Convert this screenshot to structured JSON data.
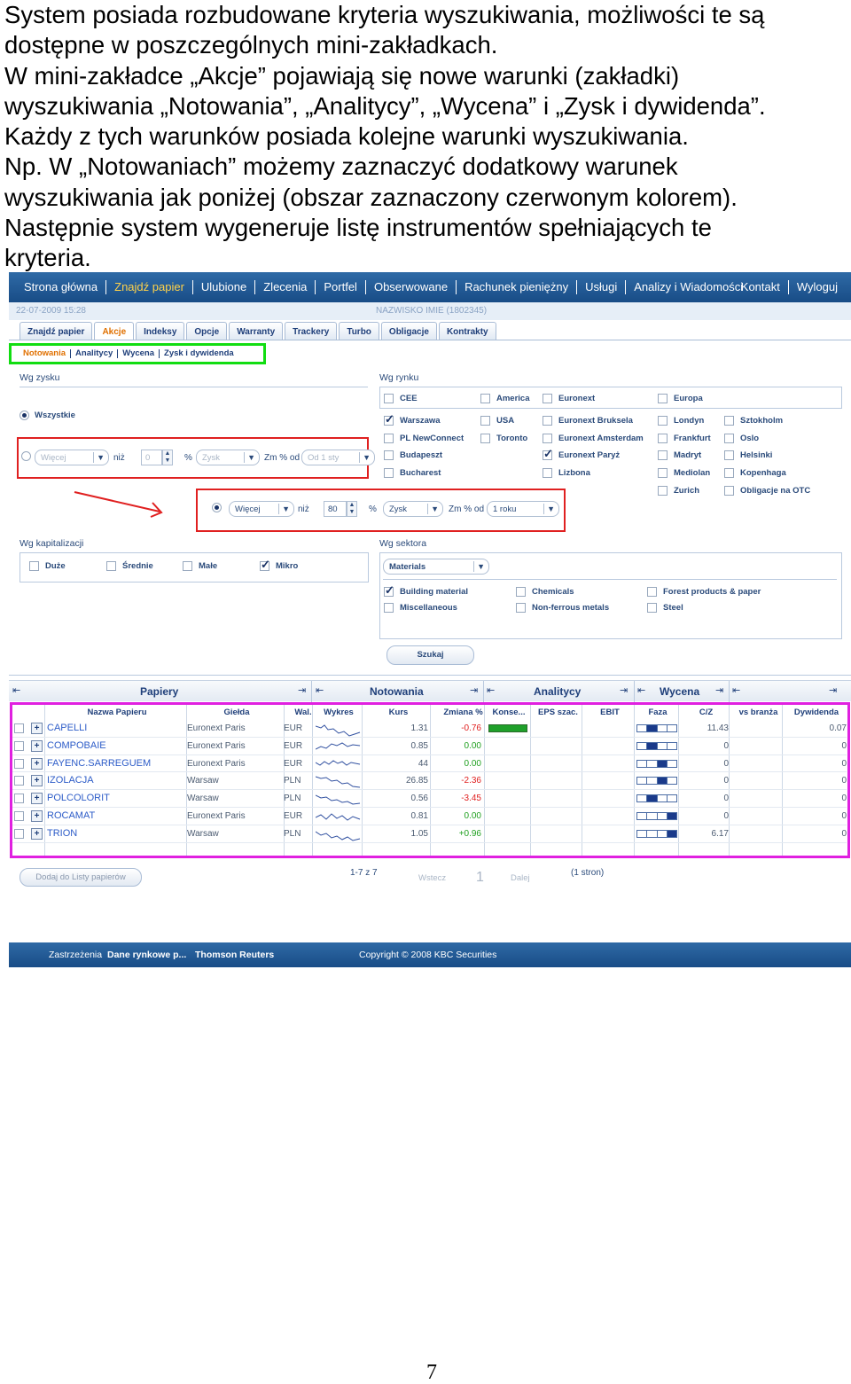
{
  "intro_lines": [
    "System posiada rozbudowane kryteria wyszukiwania, możliwości te są",
    "dostępne w poszczególnych mini-zakładkach.",
    "W mini-zakładce „Akcje” pojawiają się nowe warunki (zakładki)",
    "wyszukiwania „Notowania”, „Analitycy”, „Wycena” i „Zysk i dywidenda”.",
    "Każdy z tych warunków posiada kolejne warunki wyszukiwania.",
    "Np. W „Notowaniach” możemy zaznaczyć dodatkowy warunek",
    "wyszukiwania jak poniżej (obszar zaznaczony czerwonym kolorem).",
    "Następnie system wygeneruje listę instrumentów spełniających te",
    "kryteria."
  ],
  "topnav": {
    "items": [
      "Strona główna",
      "Znajdź papier",
      "Ulubione",
      "Zlecenia",
      "Portfel",
      "Obserwowane",
      "Rachunek pieniężny",
      "Usługi",
      "Analizy i Wiadomości"
    ],
    "right": [
      "Kontakt",
      "Wyloguj"
    ]
  },
  "infobar": {
    "date": "22-07-2009 15:28",
    "user": "NAZWISKO IMIE (1802345)"
  },
  "tabs": [
    "Znajdź papier",
    "Akcje",
    "Indeksy",
    "Opcje",
    "Warranty",
    "Trackery",
    "Turbo",
    "Obligacje",
    "Kontrakty"
  ],
  "subtabs": [
    "Notowania",
    "Analitycy",
    "Wycena",
    "Zysk i dywidenda"
  ],
  "zysk": {
    "label": "Wg zysku",
    "all": "Wszystkie",
    "more": "Więcej",
    "than": "niż",
    "value": "0",
    "pct": "%",
    "metric": "Zysk",
    "change": "Zm % od",
    "from": "Od 1 sty"
  },
  "zysk_expanded": {
    "more": "Więcej",
    "than": "niż",
    "value": "80",
    "pct": "%",
    "metric": "Zysk",
    "change": "Zm % od",
    "from": "1 roku"
  },
  "rynek": {
    "label": "Wg rynku",
    "items": [
      {
        "name": "CEE",
        "checked": false
      },
      {
        "name": "America",
        "checked": false
      },
      {
        "name": "Euronext",
        "checked": false
      },
      {
        "name": "Europa",
        "checked": false
      },
      {
        "name": "Warszawa",
        "checked": true
      },
      {
        "name": "USA",
        "checked": false
      },
      {
        "name": "Euronext Bruksela",
        "checked": false
      },
      {
        "name": "Londyn",
        "checked": false
      },
      {
        "name": "Sztokholm",
        "checked": false
      },
      {
        "name": "PL NewConnect",
        "checked": false
      },
      {
        "name": "Toronto",
        "checked": false
      },
      {
        "name": "Euronext Amsterdam",
        "checked": false
      },
      {
        "name": "Frankfurt",
        "checked": false
      },
      {
        "name": "Oslo",
        "checked": false
      },
      {
        "name": "Budapeszt",
        "checked": false
      },
      {
        "name": "Euronext Paryż",
        "checked": true
      },
      {
        "name": "Madryt",
        "checked": false
      },
      {
        "name": "Helsinki",
        "checked": false
      },
      {
        "name": "Bucharest",
        "checked": false
      },
      {
        "name": "Lizbona",
        "checked": false
      },
      {
        "name": "Mediolan",
        "checked": false
      },
      {
        "name": "Kopenhaga",
        "checked": false
      },
      {
        "name": "Zurich",
        "checked": false
      },
      {
        "name": "Obligacje na OTC",
        "checked": false
      }
    ]
  },
  "kapitalizacja": {
    "label": "Wg kapitalizacji",
    "items": [
      {
        "name": "Duże",
        "checked": false
      },
      {
        "name": "Średnie",
        "checked": false
      },
      {
        "name": "Małe",
        "checked": false
      },
      {
        "name": "Mikro",
        "checked": true
      }
    ]
  },
  "sektor": {
    "label": "Wg sektora",
    "selected": "Materials",
    "items": [
      {
        "name": "Building material",
        "checked": true
      },
      {
        "name": "Chemicals",
        "checked": false
      },
      {
        "name": "Forest products & paper",
        "checked": false
      },
      {
        "name": "Miscellaneous",
        "checked": false
      },
      {
        "name": "Non-ferrous metals",
        "checked": false
      },
      {
        "name": "Steel",
        "checked": false
      }
    ]
  },
  "search_button": "Szukaj",
  "groups": [
    "Papiery",
    "Notowania",
    "Analitycy",
    "Wycena"
  ],
  "columns": [
    "Nazwa Papieru",
    "Giełda",
    "Wal.",
    "Wykres",
    "Kurs",
    "Zmiana %",
    "Konse...",
    "EPS szac.",
    "EBIT",
    "Faza",
    "C/Z",
    "vs branża",
    "Dywidenda"
  ],
  "rows": [
    {
      "name": "CAPELLI",
      "exchange": "Euronext Paris",
      "currency": "EUR",
      "price": "1.31",
      "change": "-0.76",
      "consensus": 1.0,
      "faza": 1,
      "cz": "11.43",
      "div": "0.07"
    },
    {
      "name": "COMPOBAIE",
      "exchange": "Euronext Paris",
      "currency": "EUR",
      "price": "0.85",
      "change": "0.00",
      "consensus": 0,
      "faza": 1,
      "cz": "0",
      "div": "0"
    },
    {
      "name": "FAYENC.SARREGUEM",
      "exchange": "Euronext Paris",
      "currency": "EUR",
      "price": "44",
      "change": "0.00",
      "consensus": 0,
      "faza": 2,
      "cz": "0",
      "div": "0"
    },
    {
      "name": "IZOLACJA",
      "exchange": "Warsaw",
      "currency": "PLN",
      "price": "26.85",
      "change": "-2.36",
      "consensus": 0,
      "faza": 2,
      "cz": "0",
      "div": "0"
    },
    {
      "name": "POLCOLORIT",
      "exchange": "Warsaw",
      "currency": "PLN",
      "price": "0.56",
      "change": "-3.45",
      "consensus": 0,
      "faza": 1,
      "cz": "0",
      "div": "0"
    },
    {
      "name": "ROCAMAT",
      "exchange": "Euronext Paris",
      "currency": "EUR",
      "price": "0.81",
      "change": "0.00",
      "consensus": 0,
      "faza": 3,
      "cz": "0",
      "div": "0"
    },
    {
      "name": "TRION",
      "exchange": "Warsaw",
      "currency": "PLN",
      "price": "1.05",
      "change": "+0.96",
      "consensus": 0,
      "faza": 3,
      "cz": "6.17",
      "div": "0"
    }
  ],
  "pager": {
    "add": "Dodaj do Listy papierów",
    "range": "1-7 z 7",
    "prev": "Wstecz",
    "page": "1",
    "next": "Dalej",
    "pages": "(1 stron)"
  },
  "footer": {
    "disclaimer": "Zastrzeżenia",
    "data_label": "Dane rynkowe p...",
    "provider": "Thomson Reuters",
    "copyright": "Copyright © 2008 KBC Securities"
  },
  "page_number": "7"
}
